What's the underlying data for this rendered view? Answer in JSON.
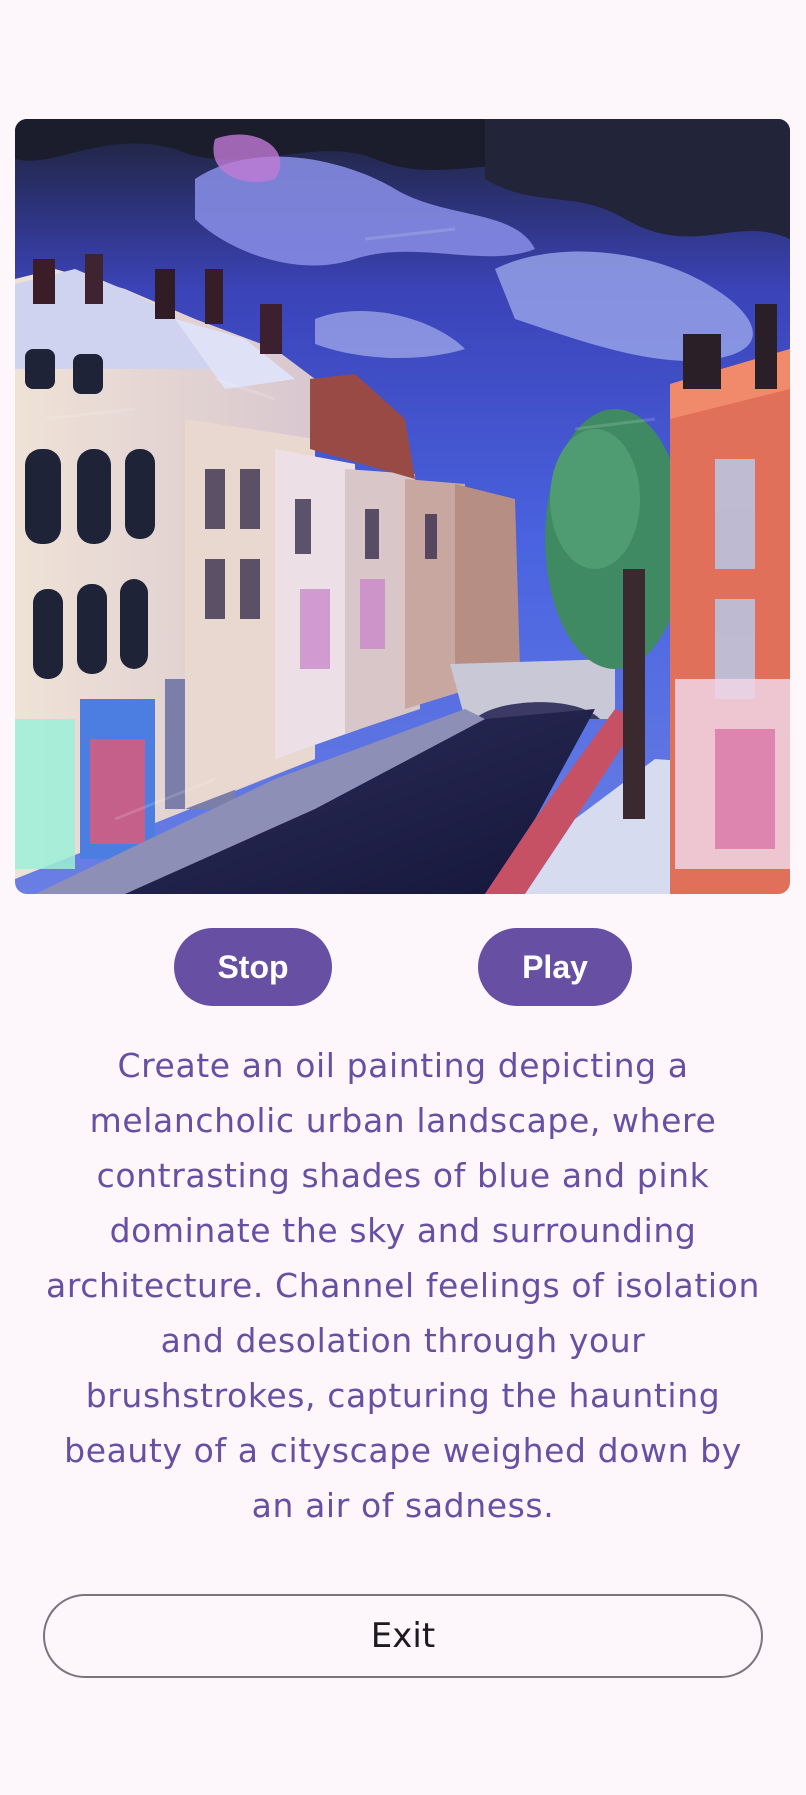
{
  "artwork": {
    "alt": "Oil painting of a melancholic city street with blue sky and pink buildings"
  },
  "controls": {
    "stop_label": "Stop",
    "play_label": "Play"
  },
  "prompt": {
    "text": "Create an oil painting depicting a melancholic urban landscape, where contrasting shades of blue and pink dominate the sky and surrounding architecture. Channel feelings of isolation and desolation through your brushstrokes, capturing the haunting beauty of a cityscape weighed down by an air of sadness."
  },
  "footer": {
    "exit_label": "Exit"
  },
  "colors": {
    "background": "#fdf7fc",
    "accent": "#6750a4",
    "on_accent": "#ffffff",
    "outline": "#79747e"
  }
}
